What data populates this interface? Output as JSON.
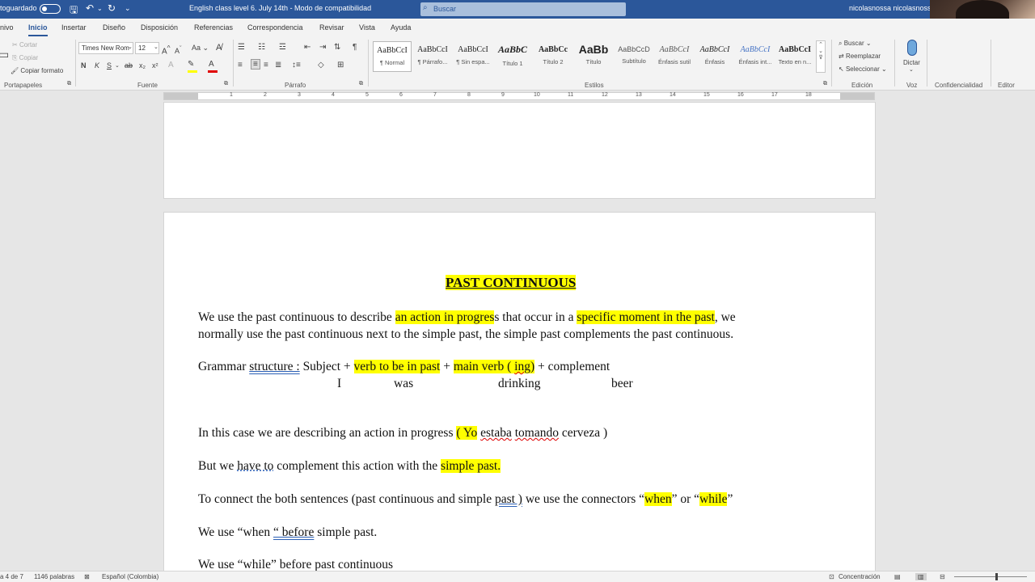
{
  "titlebar": {
    "autosave_label": "toguardado",
    "doc_title": "English class level 6. July 14th  -  Modo de compatibilidad",
    "search_placeholder": "Buscar",
    "user_name": "nicolasnossa nicolasnossa"
  },
  "tabs": [
    "nivo",
    "Inicio",
    "Insertar",
    "Diseño",
    "Disposición",
    "Referencias",
    "Correspondencia",
    "Revisar",
    "Vista",
    "Ayuda"
  ],
  "active_tab": "Inicio",
  "ribbon": {
    "clipboard": {
      "cut": "Cortar",
      "copy": "Copiar",
      "format_painter": "Copiar formato",
      "label": "Portapapeles"
    },
    "font": {
      "name": "Times New Rom",
      "size": "12",
      "bold": "N",
      "italic": "K",
      "underline": "S",
      "strike": "ab",
      "sub": "x₂",
      "sup": "x²",
      "case": "Aa",
      "grow": "A",
      "shrink": "A",
      "label": "Fuente"
    },
    "paragraph": {
      "label": "Párrafo"
    },
    "styles": {
      "items": [
        {
          "preview": "AaBbCcI",
          "name": "¶ Normal"
        },
        {
          "preview": "AaBbCcI",
          "name": "¶ Párrafo..."
        },
        {
          "preview": "AaBbCcI",
          "name": "¶ Sin espa..."
        },
        {
          "preview": "AaBbC",
          "name": "Título 1"
        },
        {
          "preview": "AaBbCc",
          "name": "Título 2"
        },
        {
          "preview": "AaBb",
          "name": "Título"
        },
        {
          "preview": "AaBbCcD",
          "name": "Subtítulo"
        },
        {
          "preview": "AaBbCcI",
          "name": "Énfasis sutil"
        },
        {
          "preview": "AaBbCcI",
          "name": "Énfasis"
        },
        {
          "preview": "AaBbCcI",
          "name": "Énfasis int..."
        },
        {
          "preview": "AaBbCcI",
          "name": "Texto en n..."
        }
      ],
      "label": "Estilos"
    },
    "editing": {
      "find": "Buscar",
      "replace": "Reemplazar",
      "select": "Seleccionar",
      "label": "Edición"
    },
    "voice": {
      "dictate": "Dictar",
      "label": "Voz"
    },
    "sensitivity": {
      "label": "Confidencialidad"
    },
    "editor": {
      "label": "Editor"
    }
  },
  "ruler_numbers": [
    "1",
    "2",
    "3",
    "4",
    "5",
    "6",
    "7",
    "8",
    "9",
    "10",
    "11",
    "12",
    "13",
    "14",
    "15",
    "16",
    "17",
    "18"
  ],
  "document": {
    "title": "PAST CONTINUOUS",
    "p1_l1": {
      "a": "We use the past continuous to describe ",
      "b": "an action in progres",
      "c": "s that occur in a ",
      "d": "specific moment in the past",
      "e": ", we"
    },
    "p1_l2": "normally use the past continuous next to the simple past, the simple past complements the past continuous.",
    "grammar": {
      "a": "Grammar ",
      "b": "structure :",
      "c": "  Subject + ",
      "d": "verb to be in past",
      "e": " + ",
      "f": "main verb ( ",
      "g": "ing",
      "h": ")",
      "i": " + complement"
    },
    "example": {
      "subject": "I",
      "verb_be": "was",
      "main_verb": "drinking",
      "complement": "beer"
    },
    "p2": {
      "a": "In this case we are describing an action in progress ",
      "b": "( Yo",
      "c": " ",
      "d": "estaba",
      "e": " ",
      "f": "tomando",
      "g": " cerveza )"
    },
    "p3": {
      "a": "But we ",
      "b": "have to",
      "c": " complement this action with the ",
      "d": "simple past."
    },
    "p4": {
      "a": "To connect the both sentences (past continuous and simple ",
      "b": "past )",
      "c": " we use the connectors “",
      "d": "when",
      "e": "” or “",
      "f": "while",
      "g": "”"
    },
    "p5": {
      "a": "We use “when ",
      "b": "“ before",
      "c": " simple past."
    },
    "p6": "We use “while” before past continuous"
  },
  "statusbar": {
    "page": "a 4 de 7",
    "words": "1146 palabras",
    "language": "Español (Colombia)",
    "focus": "Concentración"
  }
}
